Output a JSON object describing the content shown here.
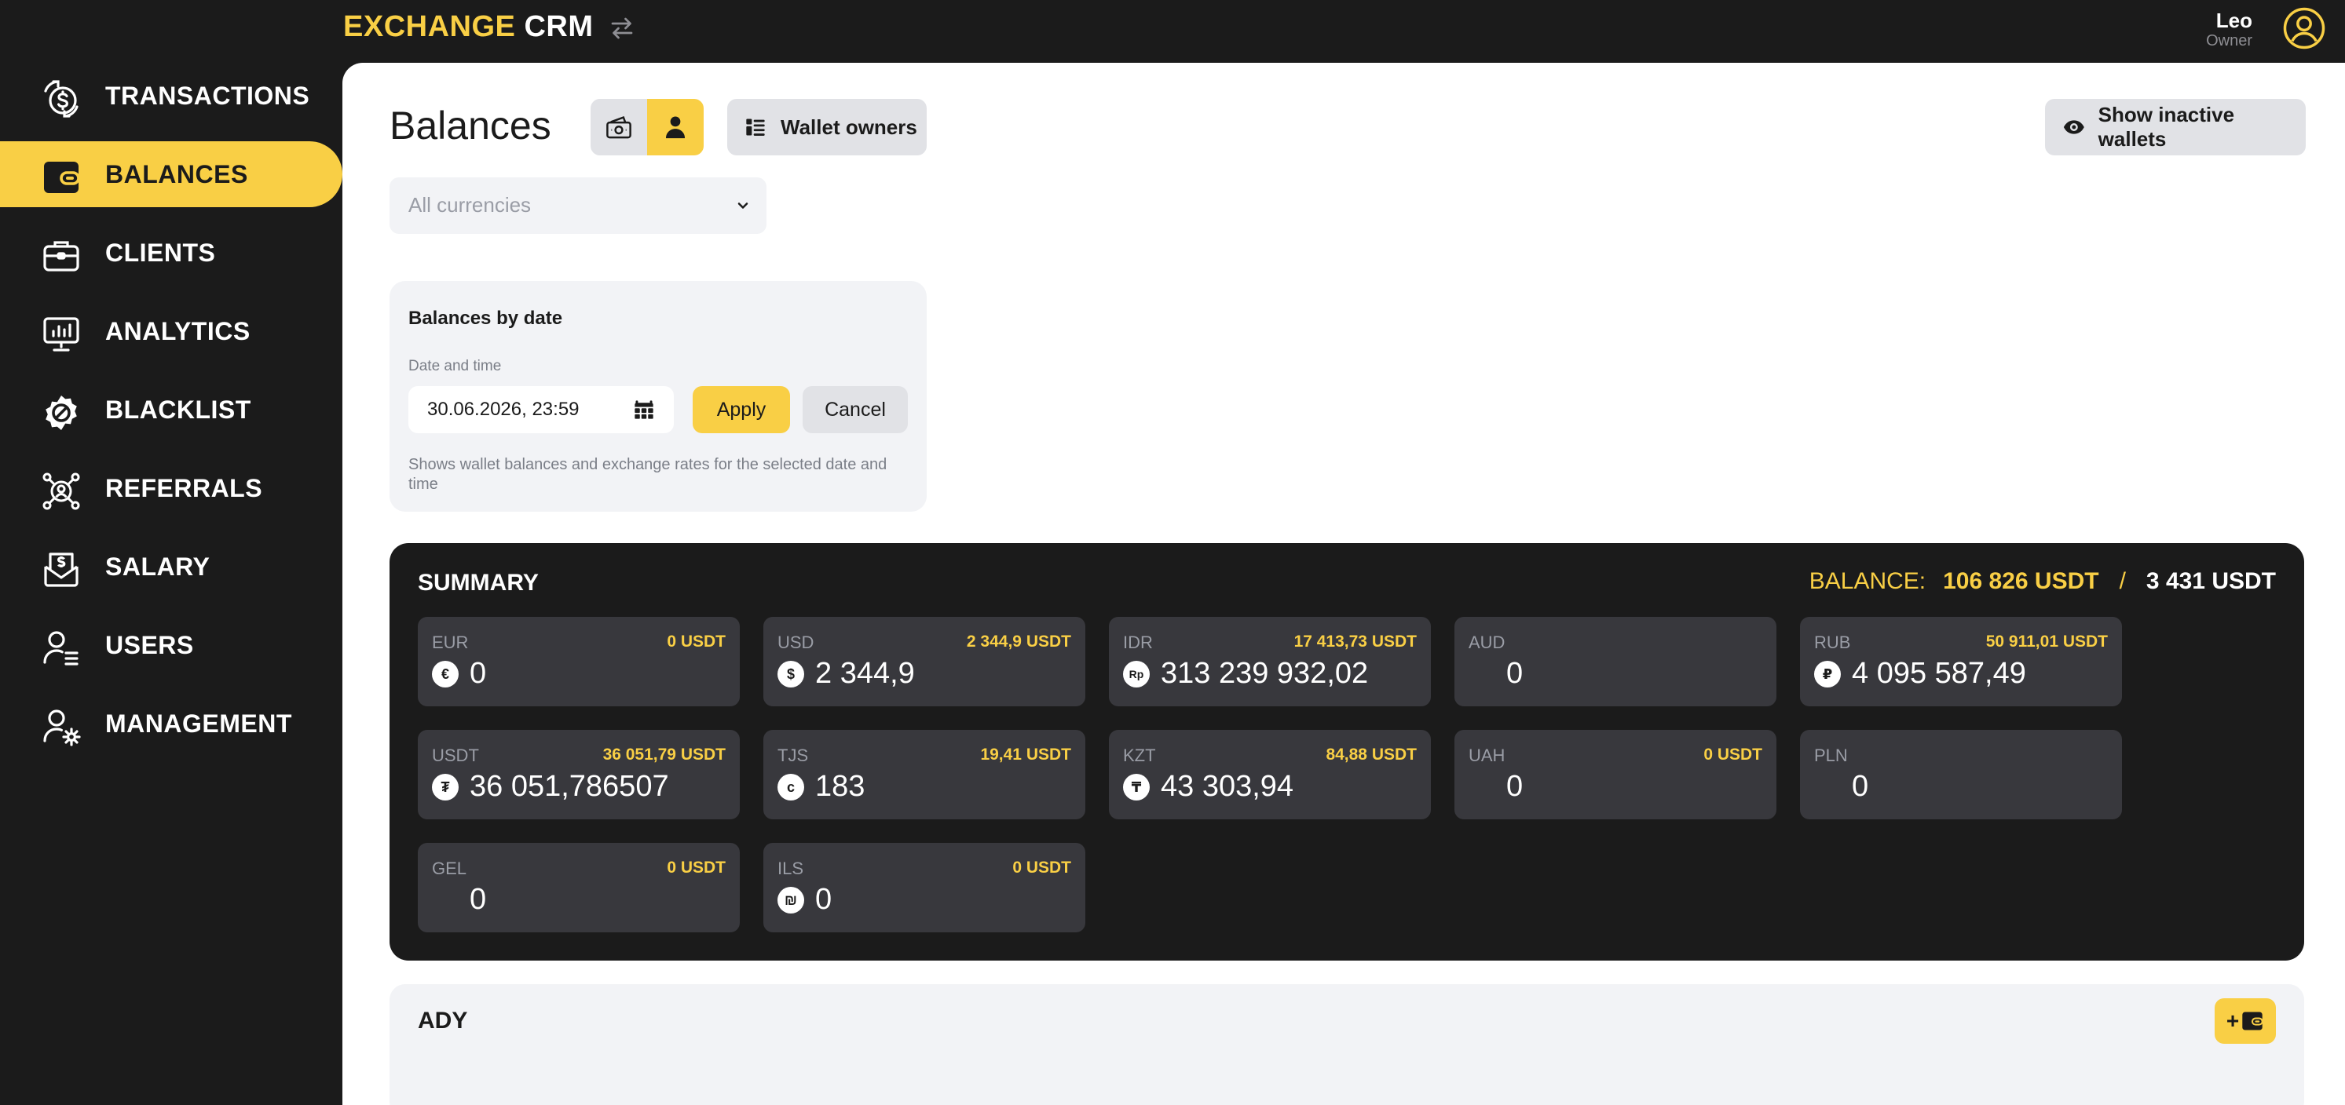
{
  "header": {
    "logo_part1": "EXCHANGE",
    "logo_part2": "CRM",
    "user_name": "Leo",
    "user_role": "Owner"
  },
  "sidebar": {
    "items": [
      {
        "label": "TRANSACTIONS",
        "icon": "dollar-exchange-icon"
      },
      {
        "label": "BALANCES",
        "icon": "wallet-icon",
        "active": true
      },
      {
        "label": "CLIENTS",
        "icon": "briefcase-icon"
      },
      {
        "label": "ANALYTICS",
        "icon": "chart-monitor-icon"
      },
      {
        "label": "BLACKLIST",
        "icon": "blocked-badge-icon"
      },
      {
        "label": "REFERRALS",
        "icon": "network-user-icon"
      },
      {
        "label": "SALARY",
        "icon": "money-envelope-icon"
      },
      {
        "label": "USERS",
        "icon": "user-list-icon"
      },
      {
        "label": "MANAGEMENT",
        "icon": "user-gear-icon"
      }
    ]
  },
  "main": {
    "title": "Balances",
    "wallet_owners_label": "Wallet owners",
    "show_inactive_label": "Show inactive wallets",
    "currency_select_placeholder": "All currencies"
  },
  "balances_by_date": {
    "title": "Balances by date",
    "field_label": "Date and time",
    "value": "30.06.2026, 23:59",
    "apply_label": "Apply",
    "cancel_label": "Cancel",
    "help_text": "Shows wallet balances and exchange rates for the selected date and time"
  },
  "summary": {
    "title": "SUMMARY",
    "balance_label": "BALANCE:",
    "balance_main": "106 826 USDT",
    "separator": "/",
    "balance_secondary": "3 431 USDT",
    "currencies": [
      {
        "code": "EUR",
        "usdt": "0 USDT",
        "symbol": "€",
        "amount": "0"
      },
      {
        "code": "USD",
        "usdt": "2 344,9 USDT",
        "symbol": "$",
        "amount": "2 344,9"
      },
      {
        "code": "IDR",
        "usdt": "17 413,73 USDT",
        "symbol": "Rp",
        "amount": "313 239 932,02"
      },
      {
        "code": "AUD",
        "usdt": "",
        "symbol": "",
        "amount": "0"
      },
      {
        "code": "RUB",
        "usdt": "50 911,01 USDT",
        "symbol": "₽",
        "amount": "4 095 587,49"
      },
      {
        "code": "USDT",
        "usdt": "36 051,79 USDT",
        "symbol": "₮",
        "amount": "36 051,786507"
      },
      {
        "code": "TJS",
        "usdt": "19,41 USDT",
        "symbol": "c",
        "amount": "183"
      },
      {
        "code": "KZT",
        "usdt": "84,88 USDT",
        "symbol": "₸",
        "amount": "43 303,94"
      },
      {
        "code": "UAH",
        "usdt": "0 USDT",
        "symbol": "",
        "amount": "0"
      },
      {
        "code": "PLN",
        "usdt": "",
        "symbol": "",
        "amount": "0"
      },
      {
        "code": "GEL",
        "usdt": "0 USDT",
        "symbol": "",
        "amount": "0"
      },
      {
        "code": "ILS",
        "usdt": "0 USDT",
        "symbol": "₪",
        "amount": "0"
      }
    ]
  },
  "groups": [
    {
      "title": "ADY",
      "add_button_label": "+"
    }
  ],
  "colors": {
    "accent": "#f9cf45",
    "dark": "#1b1b1b",
    "card_dark": "#38383d",
    "light_panel": "#f2f3f6"
  }
}
